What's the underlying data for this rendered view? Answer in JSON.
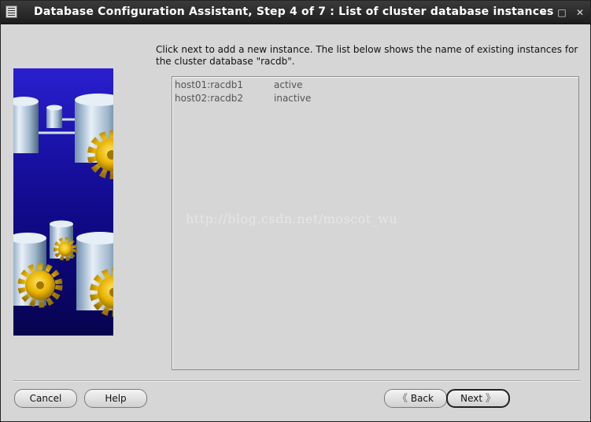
{
  "window": {
    "title": "Database Configuration Assistant, Step 4 of 7 : List of cluster database instances",
    "controls": {
      "minimize": "–",
      "maximize": "□",
      "close": "✕"
    }
  },
  "instruction": "Click next to add a new instance. The list below shows the name of existing instances for the cluster database \"racdb\".",
  "instances": [
    {
      "name": "host01:racdb1",
      "status": "active"
    },
    {
      "name": "host02:racdb2",
      "status": "inactive"
    }
  ],
  "watermark": "http://blog.csdn.net/moscot_wu",
  "buttons": {
    "cancel": "Cancel",
    "help": "Help",
    "back": "Back",
    "next": "Next",
    "back_arrow": "《",
    "next_arrow": "》"
  },
  "colors": {
    "titlebar": "#2a2a2a",
    "panel": "#d6d6d6",
    "graphic_top": "#2a1fcf",
    "graphic_bottom": "#07044e",
    "gear": "#e8b400"
  },
  "icons": [
    "app-menu-icon",
    "minimize-icon",
    "maximize-icon",
    "close-icon",
    "database-cluster-illustration",
    "back-arrow-icon",
    "next-arrow-icon"
  ]
}
